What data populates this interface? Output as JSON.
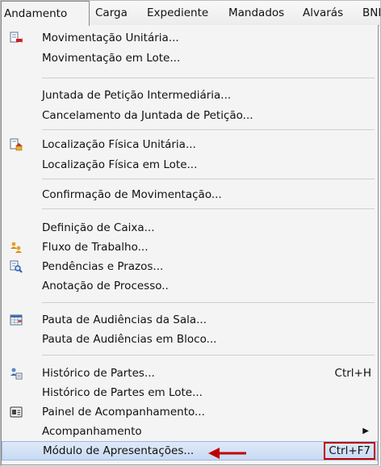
{
  "menubar": {
    "items": [
      "Andamento",
      "Carga",
      "Expediente",
      "Mandados",
      "Alvarás",
      "BNI"
    ]
  },
  "menu": {
    "items": {
      "mov_unitaria": {
        "label": "Movimentação Unitária...",
        "icon": "document-red-arrow-icon"
      },
      "mov_lote": {
        "label": "Movimentação em Lote..."
      },
      "juntada": {
        "label": "Juntada de Petição Intermediária..."
      },
      "cancel_juntada": {
        "label": "Cancelamento da Juntada de Petição..."
      },
      "loc_unitaria": {
        "label": "Localização Física Unitária...",
        "icon": "document-house-icon"
      },
      "loc_lote": {
        "label": "Localização Física em Lote..."
      },
      "confirmacao": {
        "label": "Confirmação de Movimentação..."
      },
      "caixa": {
        "label": "Definição de Caixa..."
      },
      "fluxo": {
        "label": "Fluxo de Trabalho...",
        "icon": "workflow-people-icon"
      },
      "pendencias": {
        "label": "Pendências e Prazos...",
        "icon": "document-magnifier-icon"
      },
      "anotacao": {
        "label": "Anotação de Processo.."
      },
      "pauta_sala": {
        "label": "Pauta de Audiências da Sala...",
        "icon": "calendar-grid-icon"
      },
      "pauta_bloco": {
        "label": "Pauta de Audiências em Bloco..."
      },
      "historico": {
        "label": "Histórico de Partes...",
        "icon": "people-history-icon",
        "shortcut": "Ctrl+H"
      },
      "historico_lote": {
        "label": "Histórico de Partes em Lote..."
      },
      "painel": {
        "label": "Painel de Acompanhamento...",
        "icon": "panel-card-icon"
      },
      "acompanhamento": {
        "label": "Acompanhamento",
        "has_submenu": true
      },
      "modulo": {
        "label": "Módulo de Apresentações...",
        "shortcut": "Ctrl+F7",
        "highlighted": true
      }
    }
  },
  "colors": {
    "annotation_red": "#c00000",
    "highlight_blue": "#c8daf3"
  }
}
